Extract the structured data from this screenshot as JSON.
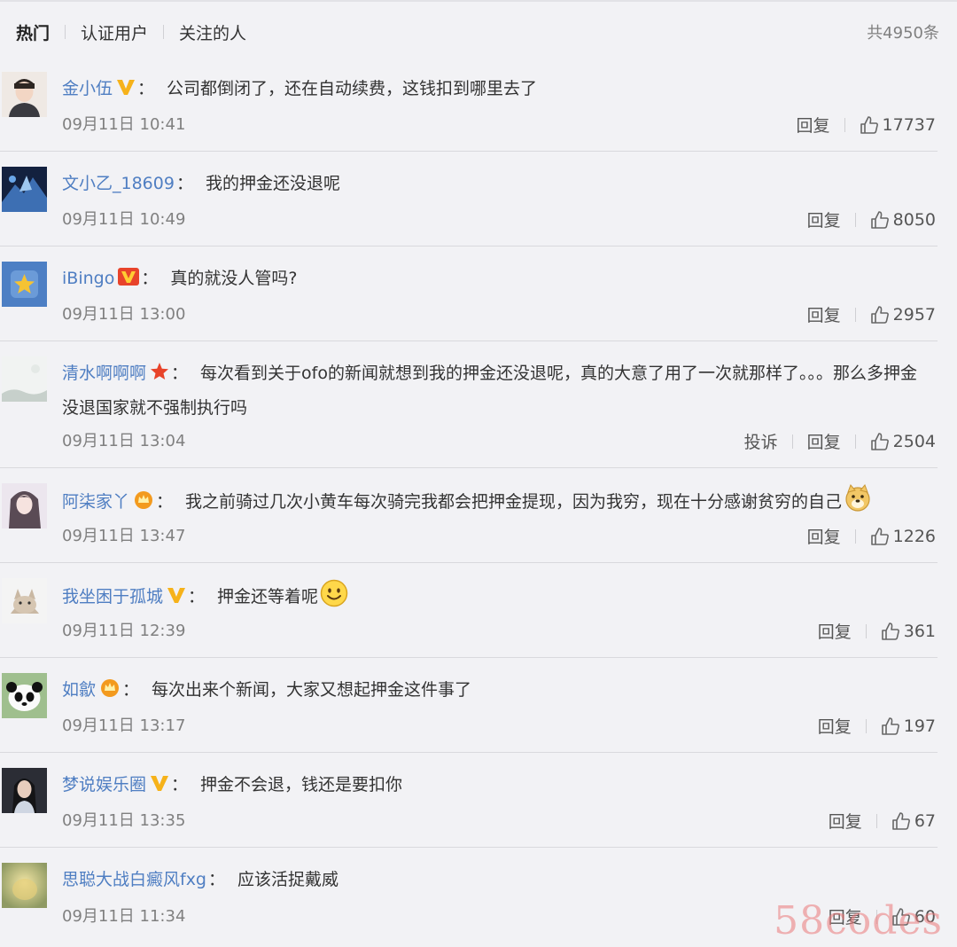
{
  "tabs": [
    {
      "label": "热门",
      "active": true
    },
    {
      "label": "认证用户",
      "active": false
    },
    {
      "label": "关注的人",
      "active": false
    }
  ],
  "total_label": "共4950条",
  "actions": {
    "reply_label": "回复",
    "report_label": "投诉"
  },
  "colors": {
    "username": "#4f7ec2",
    "background": "#f2f2f5",
    "meta": "#808080"
  },
  "comments": [
    {
      "user": "金小伍",
      "badge": "gold-v",
      "text": "公司都倒闭了，还在自动续费，这钱扣到哪里去了",
      "time": "09月11日 10:41",
      "likes": "17737",
      "has_report": false,
      "emoji": ""
    },
    {
      "user": "文小乙_18609",
      "badge": "",
      "text": "我的押金还没退呢",
      "time": "09月11日 10:49",
      "likes": "8050",
      "has_report": false,
      "emoji": ""
    },
    {
      "user": "iBingo",
      "badge": "red-v",
      "text": "真的就没人管吗?",
      "time": "09月11日 13:00",
      "likes": "2957",
      "has_report": false,
      "emoji": ""
    },
    {
      "user": "清水啊啊啊",
      "badge": "red-star",
      "text": "每次看到关于ofo的新闻就想到我的押金还没退呢，真的大意了用了一次就那样了。。。那么多押金没退国家就不强制执行吗",
      "time": "09月11日 13:04",
      "likes": "2504",
      "has_report": true,
      "emoji": ""
    },
    {
      "user": "阿柒家丫",
      "badge": "crown",
      "text": "我之前骑过几次小黄车每次骑完我都会把押金提现，因为我穷，现在十分感谢贫穷的自己",
      "time": "09月11日 13:47",
      "likes": "1226",
      "has_report": false,
      "emoji": "doge-icon"
    },
    {
      "user": "我坐困于孤城",
      "badge": "gold-v",
      "text": "押金还等着呢",
      "time": "09月11日 12:39",
      "likes": "361",
      "has_report": false,
      "emoji": "smile-icon"
    },
    {
      "user": "如歙",
      "badge": "crown",
      "text": "每次出来个新闻，大家又想起押金这件事了",
      "time": "09月11日 13:17",
      "likes": "197",
      "has_report": false,
      "emoji": ""
    },
    {
      "user": "梦说娱乐圈",
      "badge": "gold-v",
      "text": "押金不会退，钱还是要扣你",
      "time": "09月11日 13:35",
      "likes": "67",
      "has_report": false,
      "emoji": ""
    },
    {
      "user": "思聪大战白癜风fxg",
      "badge": "",
      "text": "应该活捉戴威",
      "time": "09月11日 11:34",
      "likes": "60",
      "has_report": false,
      "emoji": ""
    }
  ],
  "watermark": "58codes"
}
